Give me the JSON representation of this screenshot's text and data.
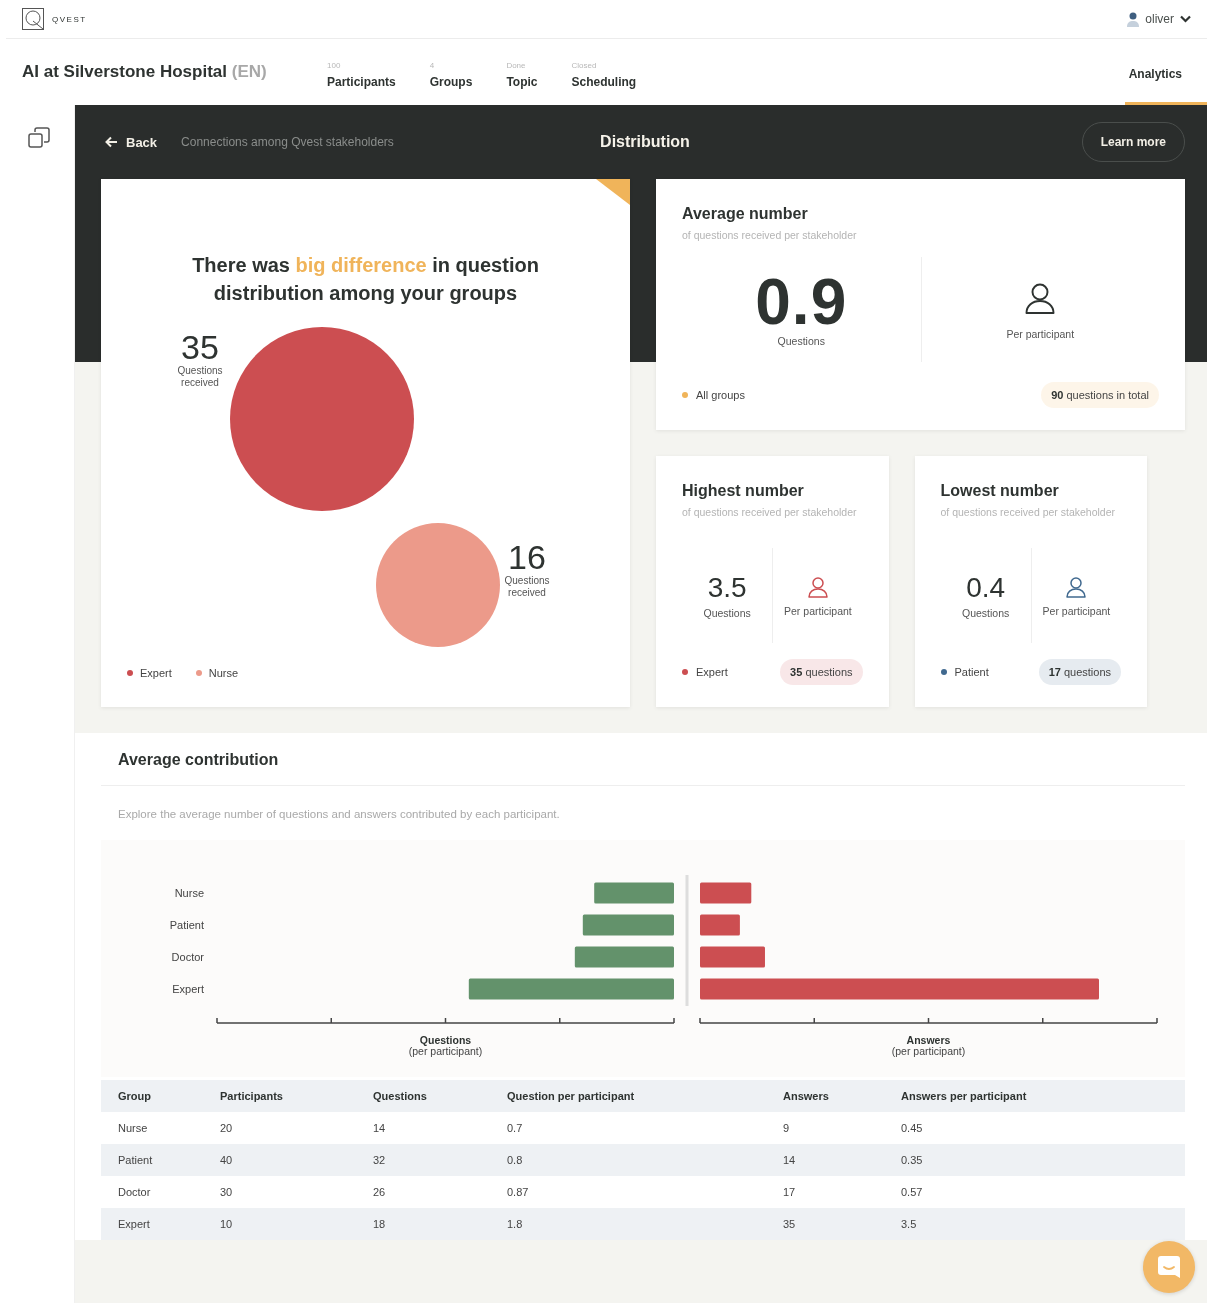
{
  "app": {
    "logo": "QVEST",
    "user": "oliver"
  },
  "header": {
    "title": "AI at Silverstone Hospital",
    "language": "(EN)",
    "stats": [
      {
        "value": "100",
        "label": "Participants"
      },
      {
        "value": "4",
        "label": "Groups"
      },
      {
        "value": "Done",
        "label": "Topic"
      },
      {
        "value": "Closed",
        "label": "Scheduling"
      }
    ],
    "tabs": [
      {
        "label": "Analytics",
        "selected": true
      }
    ]
  },
  "toolbar": {
    "back": "Back",
    "breadcrumb": "Connections among Qvest stakeholders",
    "title": "Distribution",
    "action": "Learn more"
  },
  "distribution": {
    "headline": "There was **big difference** in question distribution among your groups",
    "bubbles": [
      {
        "value": "35",
        "caption": "Questions received",
        "color": "#cc4e51"
      },
      {
        "value": "16",
        "caption": "Questions received",
        "color": "#ec9a8a"
      }
    ],
    "legend": [
      {
        "label": "Expert",
        "color": "#cc4e51"
      },
      {
        "label": "Nurse",
        "color": "#ec9a8a"
      }
    ]
  },
  "stat_cards": [
    {
      "kind": "large",
      "title": "Average number",
      "subtitle": "of questions received per stakeholder",
      "value": "0.9",
      "value_label": "Questions",
      "unit_label": "Per participant",
      "group": "All groups",
      "color": "#f0b45a",
      "count": "**90** questions in total"
    },
    {
      "kind": "small",
      "title": "Highest number",
      "subtitle": "of questions received per stakeholder",
      "value": "3.5",
      "value_label": "Questions",
      "unit_label": "Per participant",
      "group": "Expert",
      "color": "#cc4e51",
      "count": "**35** questions"
    },
    {
      "kind": "small",
      "title": "Lowest number",
      "subtitle": "of questions received per stakeholder",
      "value": "0.4",
      "value_label": "Questions",
      "unit_label": "Per participant",
      "group": "Patient",
      "color": "#40698f",
      "count": "**17** questions"
    }
  ],
  "contribution": {
    "title": "Average contribution",
    "description": "Explore the average number of questions and answers contributed by each participant.",
    "chart": {
      "groups": [
        "Nurse",
        "Patient",
        "Doctor",
        "Expert"
      ],
      "axes": [
        {
          "title": "Questions",
          "subtitle": "(per participant)",
          "color": "#63926b"
        },
        {
          "title": "Answers",
          "subtitle": "(per participant)",
          "color": "#cc4e51"
        }
      ]
    },
    "table": {
      "columns": [
        "Group",
        "Participants",
        "Questions",
        "Question per participant",
        "Answers",
        "Answers per participant"
      ],
      "rows": [
        [
          "Nurse",
          "20",
          "14",
          "0.7",
          "9",
          "0.45"
        ],
        [
          "Patient",
          "40",
          "32",
          "0.8",
          "14",
          "0.35"
        ],
        [
          "Doctor",
          "30",
          "26",
          "0.87",
          "17",
          "0.57"
        ],
        [
          "Expert",
          "10",
          "18",
          "1.8",
          "35",
          "3.5"
        ]
      ]
    }
  }
}
